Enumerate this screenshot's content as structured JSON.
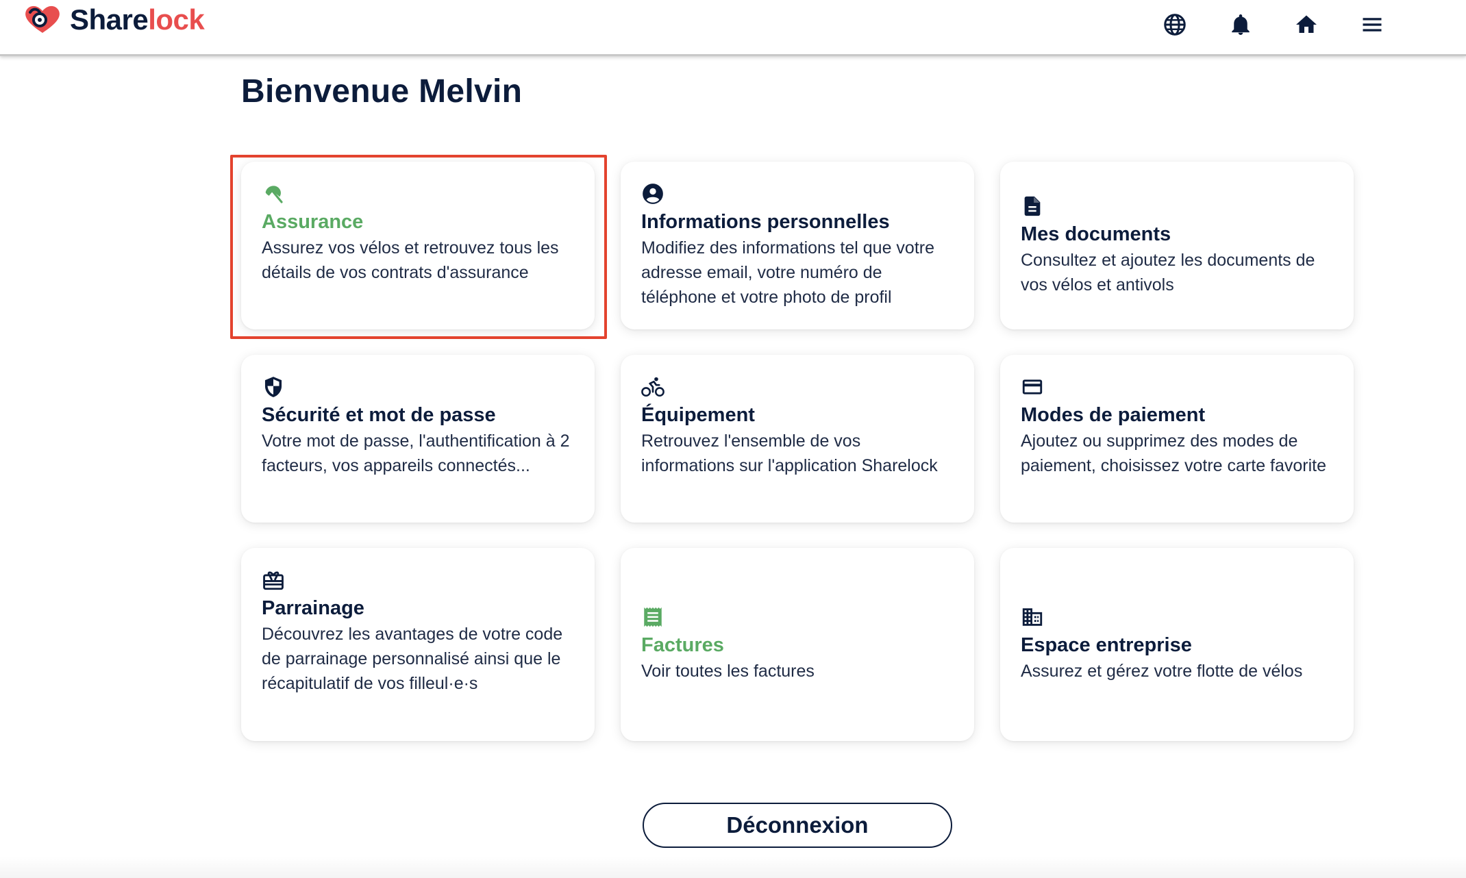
{
  "header": {
    "logo_part1": "Share",
    "logo_part2": "lock",
    "icons": [
      "globe-icon",
      "bell-icon",
      "home-icon",
      "menu-icon"
    ]
  },
  "page": {
    "title": "Bienvenue Melvin"
  },
  "cards": [
    {
      "icon": "umbrella-icon",
      "title": "Assurance",
      "title_color": "#5aaa63",
      "description": "Assurez vos vélos et retrouvez tous les détails de vos contrats d'assurance",
      "highlighted": true
    },
    {
      "icon": "account-circle-icon",
      "title": "Informations personnelles",
      "description": "Modifiez des informations tel que votre adresse email, votre numéro de téléphone et votre photo de profil"
    },
    {
      "icon": "document-icon",
      "title": "Mes documents",
      "description": "Consultez et ajoutez les documents de vos vélos et antivols"
    },
    {
      "icon": "shield-icon",
      "title": "Sécurité et mot de passe",
      "description": "Votre mot de passe, l'authentification à 2 facteurs, vos appareils connectés..."
    },
    {
      "icon": "bike-icon",
      "title": "Équipement",
      "description": "Retrouvez l'ensemble de vos informations sur l'application Sharelock"
    },
    {
      "icon": "credit-card-icon",
      "title": "Modes de paiement",
      "description": "Ajoutez ou supprimez des modes de paiement, choisissez votre carte favorite"
    },
    {
      "icon": "gift-card-icon",
      "title": "Parrainage",
      "description": "Découvrez les avantages de votre code de parrainage personnalisé ainsi que le récapitulatif de vos filleul·e·s"
    },
    {
      "icon": "receipt-icon",
      "title": "Factures",
      "title_color": "#5aaa63",
      "description": "Voir toutes les factures"
    },
    {
      "icon": "building-icon",
      "title": "Espace entreprise",
      "description": "Assurez et gérez votre flotte de vélos"
    }
  ],
  "logout_label": "Déconnexion",
  "colors": {
    "navy": "#0c1c3b",
    "brand_red": "#e84e4e",
    "accent_green": "#5aaa63",
    "highlight_red": "#e3432e"
  }
}
